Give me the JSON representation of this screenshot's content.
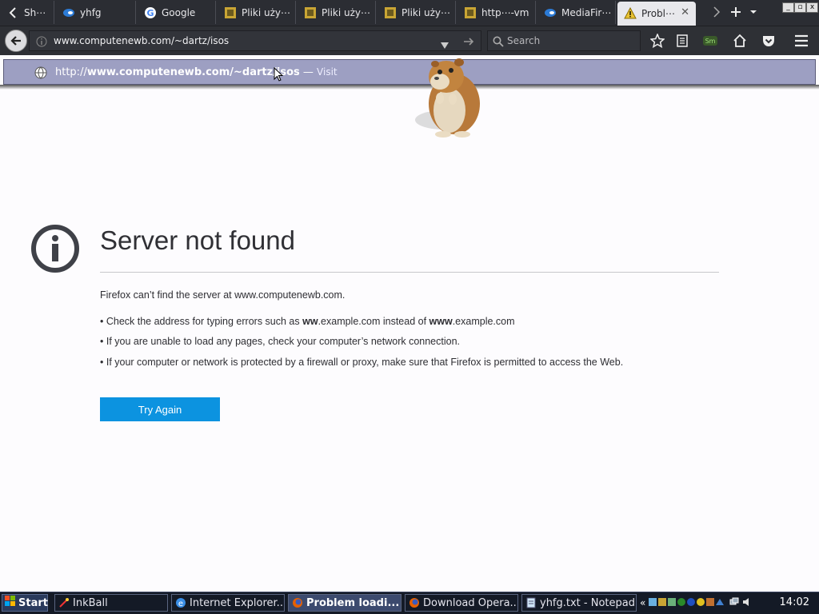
{
  "tabs": [
    {
      "label": "Sh⋯",
      "icon": "chevron-left-icon"
    },
    {
      "label": "yhfg",
      "icon": "mediafire-icon"
    },
    {
      "label": "Google",
      "icon": "google-icon"
    },
    {
      "label": "Pliki uży⋯",
      "icon": "site-icon"
    },
    {
      "label": "Pliki uży⋯",
      "icon": "site-icon"
    },
    {
      "label": "Pliki uży⋯",
      "icon": "site-icon"
    },
    {
      "label": "http⋯-vm",
      "icon": "site-icon"
    },
    {
      "label": "MediaFir⋯",
      "icon": "mediafire-icon"
    },
    {
      "label": "Probl⋯",
      "icon": "warning-icon",
      "active": true
    }
  ],
  "navbar": {
    "url": "www.computenewb.com/~dartz/isos",
    "search_placeholder": "Search"
  },
  "suggestion": {
    "prefix": "http://",
    "url_bold": "www.computenewb.com/~dartz/isos",
    "separator": " — ",
    "action": "Visit"
  },
  "error": {
    "title": "Server not found",
    "message": "Firefox can’t find the server at www.computenewb.com.",
    "bullet1_a": "• Check the address for typing errors such as ",
    "bullet1_b": "ww",
    "bullet1_c": ".example.com instead of ",
    "bullet1_d": "www",
    "bullet1_e": ".example.com",
    "bullet2": "• If you are unable to load any pages, check your computer’s network connection.",
    "bullet3": "• If your computer or network is protected by a firewall or proxy, make sure that Firefox is permitted to access the Web.",
    "try_again": "Try Again"
  },
  "taskbar": {
    "start": "Start",
    "items": [
      {
        "label": "InkBall"
      },
      {
        "label": "Internet Explorer..."
      },
      {
        "label": "Problem loadi...",
        "active": true
      },
      {
        "label": "Download Opera..."
      },
      {
        "label": "yhfg.txt - Notepad"
      }
    ],
    "tray_chevron": "«",
    "clock": "14:02"
  },
  "colors": {
    "accent": "#0c93e0",
    "tab_bar": "#2b2d33",
    "suggestion_bg": "#9d9fc2"
  }
}
